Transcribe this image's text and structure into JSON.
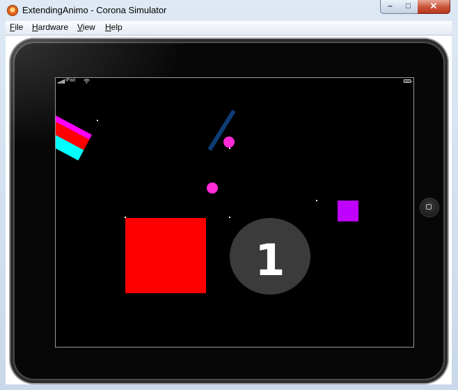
{
  "window": {
    "title": "ExtendingAnimo - Corona Simulator",
    "controls": {
      "minimize": "–",
      "maximize": "□",
      "close": "✕"
    }
  },
  "menu": [
    "File",
    "Hardware",
    "View",
    "Help"
  ],
  "device": {
    "status_bar": {
      "carrier": "iPad",
      "signal_icon": "signal-bars-icon",
      "wifi_icon": "wifi-icon",
      "battery_icon": "battery-icon"
    },
    "home_button_icon": "home-button-icon"
  },
  "scene": {
    "counter_text": "1",
    "colors": {
      "stripe_magenta": "#ff00ff",
      "stripe_red": "#ff0000",
      "stripe_cyan": "#00ffff",
      "ball": "#ff2ad8",
      "rod": "#0d3d75",
      "red_square": "#ff0000",
      "purple_square": "#bf00ff",
      "badge": "#3b3b3b"
    }
  }
}
